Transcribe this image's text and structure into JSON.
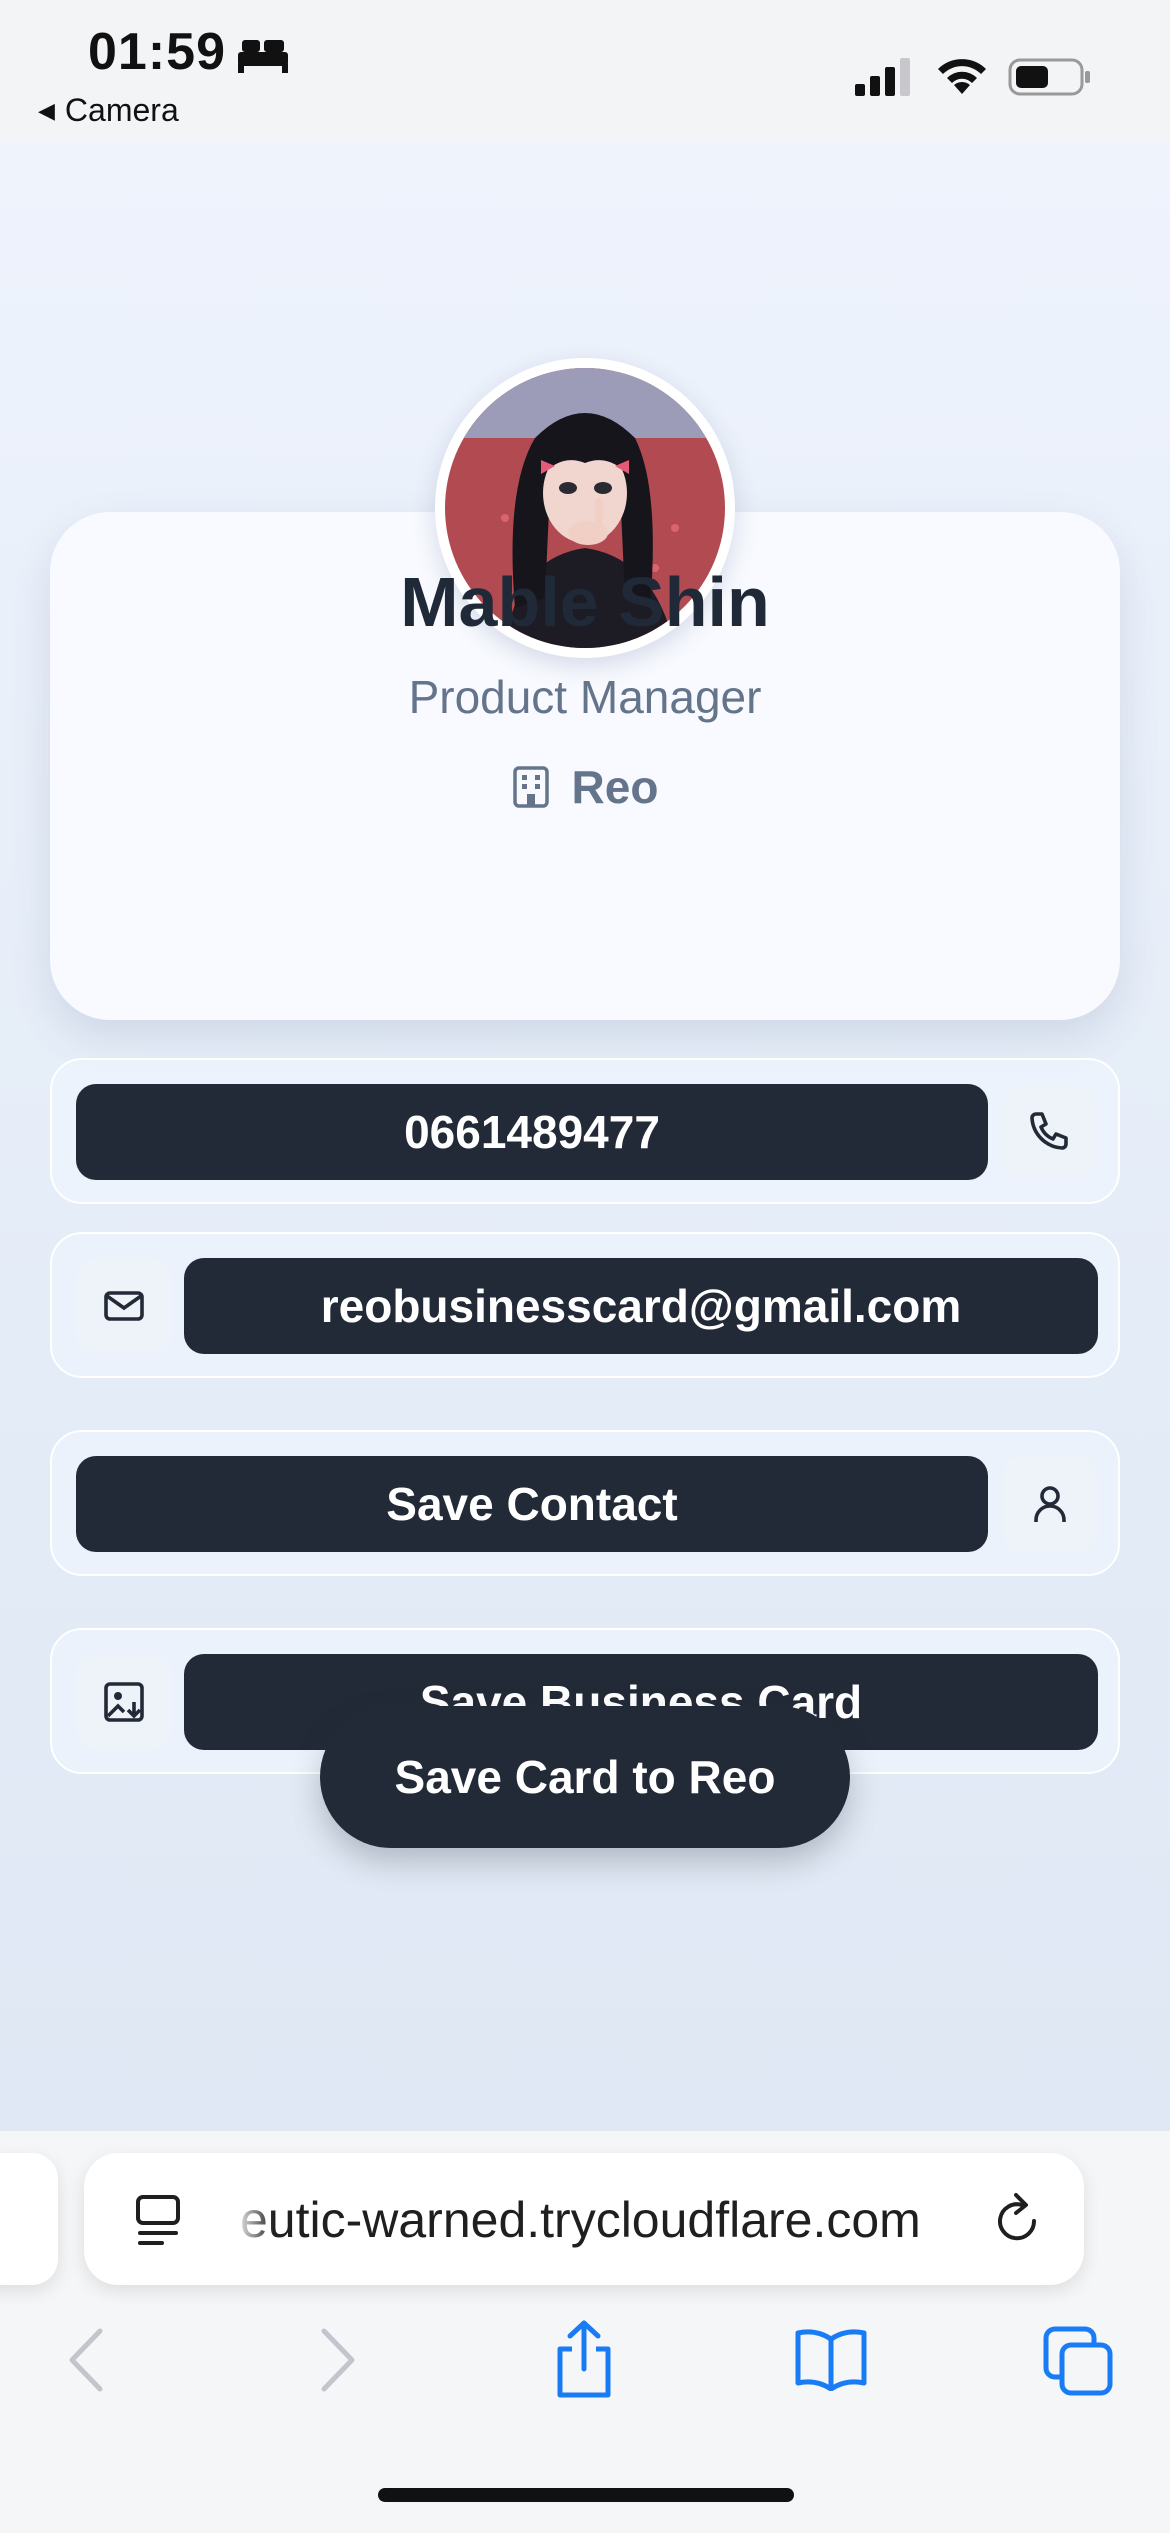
{
  "status_bar": {
    "time": "01:59",
    "back_app": "Camera",
    "icons": [
      "sleep-bed-icon",
      "cellular-signal-icon",
      "wifi-icon",
      "battery-icon"
    ]
  },
  "profile": {
    "name": "Mable Shin",
    "title": "Product Manager",
    "company": "Reo"
  },
  "contacts": {
    "phone": "0661489477",
    "email": "reobusinesscard@gmail.com"
  },
  "actions": {
    "save_contact": "Save Contact",
    "save_business_card": "Save Business Card",
    "save_card_to_reo": "Save Card to Reo"
  },
  "browser": {
    "url": "eutic-warned.trycloudflare.com",
    "toolbar_icons": [
      "back-arrow-icon",
      "forward-arrow-icon",
      "share-icon",
      "bookmarks-icon",
      "tabs-icon"
    ]
  },
  "colors": {
    "primary_dark": "#232a37",
    "name_text": "#1f2937",
    "muted_text": "#64748b",
    "ios_blue": "#1a7cf5"
  }
}
